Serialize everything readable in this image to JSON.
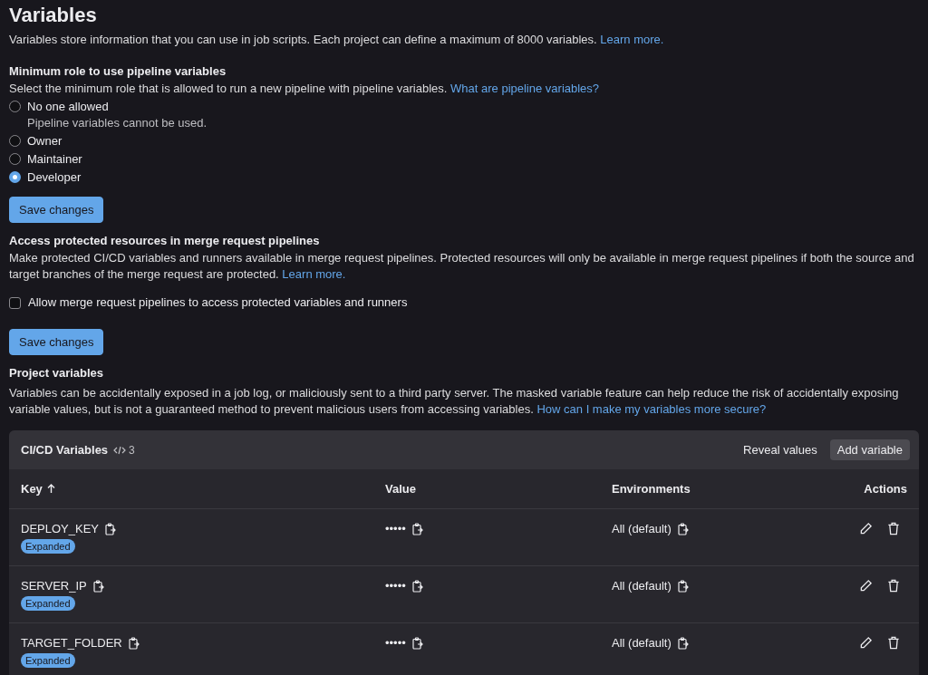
{
  "page": {
    "title": "Variables",
    "intro": "Variables store information that you can use in job scripts. Each project can define a maximum of 8000 variables.",
    "intro_link": "Learn more."
  },
  "role_section": {
    "heading": "Minimum role to use pipeline variables",
    "description": "Select the minimum role that is allowed to run a new pipeline with pipeline variables.",
    "link": "What are pipeline variables?",
    "options": [
      {
        "label": "No one allowed",
        "help": "Pipeline variables cannot be used.",
        "selected": false
      },
      {
        "label": "Owner",
        "selected": false
      },
      {
        "label": "Maintainer",
        "selected": false
      },
      {
        "label": "Developer",
        "selected": true
      }
    ],
    "button": "Save changes"
  },
  "protected_section": {
    "heading": "Access protected resources in merge request pipelines",
    "description": "Make protected CI/CD variables and runners available in merge request pipelines. Protected resources will only be available in merge request pipelines if both the source and target branches of the merge request are protected.",
    "link": "Learn more.",
    "checkbox": {
      "label": "Allow merge request pipelines to access protected variables and runners",
      "checked": false
    },
    "button": "Save changes"
  },
  "project_variables": {
    "heading": "Project variables",
    "description": "Variables can be accidentally exposed in a job log, or maliciously sent to a third party server. The masked variable feature can help reduce the risk of accidentally exposing variable values, but is not a guaranteed method to prevent malicious users from accessing variables.",
    "link": "How can I make my variables more secure?"
  },
  "card": {
    "title": "CI/CD Variables",
    "count": "3",
    "actions": [
      "Reveal values",
      "Add variable"
    ],
    "columns": [
      "Key",
      "Value",
      "Environments",
      "Actions"
    ],
    "rows": [
      {
        "key": "DEPLOY_KEY",
        "badge": "Expanded",
        "value": "•••••",
        "environment": "All (default)"
      },
      {
        "key": "SERVER_IP",
        "badge": "Expanded",
        "value": "•••••",
        "environment": "All (default)"
      },
      {
        "key": "TARGET_FOLDER",
        "badge": "Expanded",
        "value": "•••••",
        "environment": "All (default)"
      }
    ]
  }
}
